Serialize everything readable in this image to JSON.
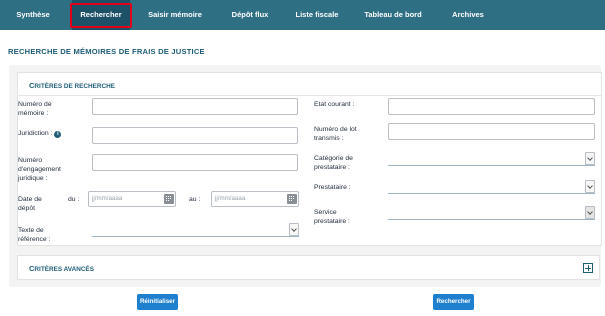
{
  "nav": {
    "tabs": [
      {
        "label": "Synthèse"
      },
      {
        "label": "Rechercher"
      },
      {
        "label": "Saisir mémoire"
      },
      {
        "label": "Dépôt flux"
      },
      {
        "label": "Liste fiscale"
      },
      {
        "label": "Tableau de bord"
      },
      {
        "label": "Archives"
      }
    ],
    "active_tab": "Rechercher"
  },
  "page_title": "Recherche de mémoires de frais de justice",
  "criteria": {
    "title_first": "C",
    "title_rest": "ritères de recherche",
    "fields": {
      "numero_memoire_label_l1": "Numéro de",
      "numero_memoire_label_l2": "mémoire :",
      "juridiction_label": "Juridiction :",
      "engagement_label_l1": "Numéro",
      "engagement_label_l2": "d'engagement",
      "engagement_label_l3": "juridique :",
      "date_depot_label_l1": "Date de",
      "date_depot_label_l2": "dépôt",
      "du_label": "du :",
      "au_label": "au :",
      "date_placeholder": "jj/mm/aaaa",
      "texte_ref_label_l1": "Texte de",
      "texte_ref_label_l2": "référence :",
      "etat_courant_label": "Etat courant :",
      "numero_lot_label_l1": "Numéro de lot",
      "numero_lot_label_l2": "transmis :",
      "categorie_label_l1": "Catégorie de",
      "categorie_label_l2": "prestataire :",
      "prestataire_label": "Prestataire :",
      "service_label_l1": "Service",
      "service_label_l2": "prestataire :"
    }
  },
  "advanced": {
    "title_first": "C",
    "title_rest": "ritères avancés"
  },
  "buttons": {
    "reset": "Réinitialiser",
    "search": "Rechercher"
  },
  "colors": {
    "nav_bg": "#2f6f83",
    "nav_active_bg": "#1c5168",
    "active_outline": "#e3001b",
    "title": "#1f5d79",
    "button": "#1e7fcf"
  }
}
